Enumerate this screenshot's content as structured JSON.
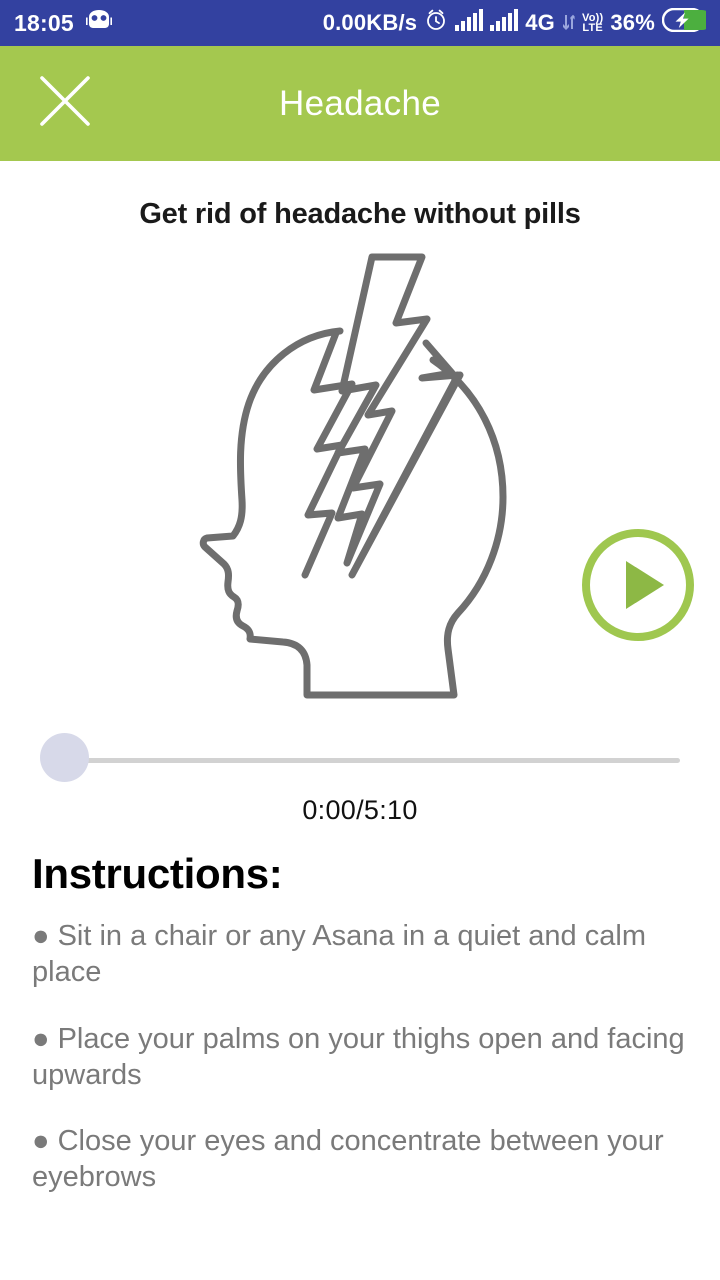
{
  "statusbar": {
    "time": "18:05",
    "android_icon": "android-robot-icon",
    "network_speed": "0.00KB/s",
    "alarm_icon": "alarm-clock-icon",
    "signal1_icon": "signal-bars-icon",
    "signal2_icon": "signal-bars-icon",
    "network_type": "4G",
    "volte_top": "Vo))",
    "volte_bottom": "LTE",
    "battery_percent": "36%",
    "battery_icon": "battery-charging-icon",
    "bg_color": "#3341a0",
    "fg_color": "#ffffff"
  },
  "appbar": {
    "close_icon": "close-x-icon",
    "title": "Headache",
    "bg_color": "#a4c84f",
    "title_color": "#ffffff"
  },
  "content": {
    "subtitle": "Get rid of headache without pills",
    "illustration_icon": "head-with-lightning-bolt-icon",
    "illustration_color": "#6e6e6e"
  },
  "player": {
    "play_icon": "play-circle-icon",
    "play_color": "#9fc74f",
    "seek_thumb_icon": "seek-thumb",
    "seek_progress_percent": 0,
    "track_color": "#d2d2d2",
    "thumb_color": "#d7d9e9",
    "timecode": "0:00/5:10",
    "current_time": "0:00",
    "total_time": "5:10"
  },
  "instructions": {
    "heading": "Instructions:",
    "items": [
      "● Sit in a chair or any Asana in a quiet and calm place",
      " ● Place your palms on your thighs open and facing upwards",
      " ● Close your eyes and concentrate between your eyebrows"
    ],
    "text_color": "#7a7a7a"
  }
}
